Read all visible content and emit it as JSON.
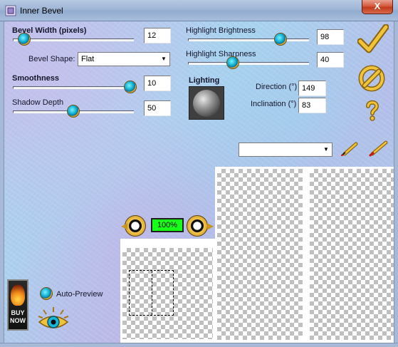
{
  "window": {
    "title": "Inner Bevel",
    "close_label": "X"
  },
  "controls": {
    "bevel_width": {
      "label": "Bevel Width (pixels)",
      "value": "12"
    },
    "bevel_shape": {
      "label": "Bevel Shape:",
      "value": "Flat"
    },
    "smoothness": {
      "label": "Smoothness",
      "value": "10"
    },
    "shadow_depth": {
      "label": "Shadow Depth",
      "value": "50"
    },
    "highlight_brightness": {
      "label": "Highlight Brightness",
      "value": "98"
    },
    "highlight_sharpness": {
      "label": "Highlight Sharpness",
      "value": "40"
    },
    "lighting": {
      "label": "Lighting"
    },
    "direction": {
      "label": "Direction (°)",
      "value": "149"
    },
    "inclination": {
      "label": "Inclination (°)",
      "value": "83"
    },
    "preset_select": {
      "value": ""
    },
    "auto_preview": {
      "label": "Auto-Preview"
    },
    "zoom": {
      "value": "100%"
    }
  },
  "buy_now": {
    "line1": "BUY",
    "line2": "NOW"
  },
  "icons": {
    "ok": "checkmark-icon",
    "cancel": "cancel-icon",
    "help": "question-mark-icon",
    "eyedropper": "eyedropper-icon",
    "pen": "pen-icon",
    "zoom_out": "eye-left-icon",
    "zoom_in": "eye-right-icon",
    "preview_eye": "gold-eye-icon"
  },
  "colors": {
    "accent_gold": "#c8961e",
    "knob_teal": "#16b7d8",
    "zoom_green": "#18ff18",
    "close_red": "#c23a1c"
  }
}
